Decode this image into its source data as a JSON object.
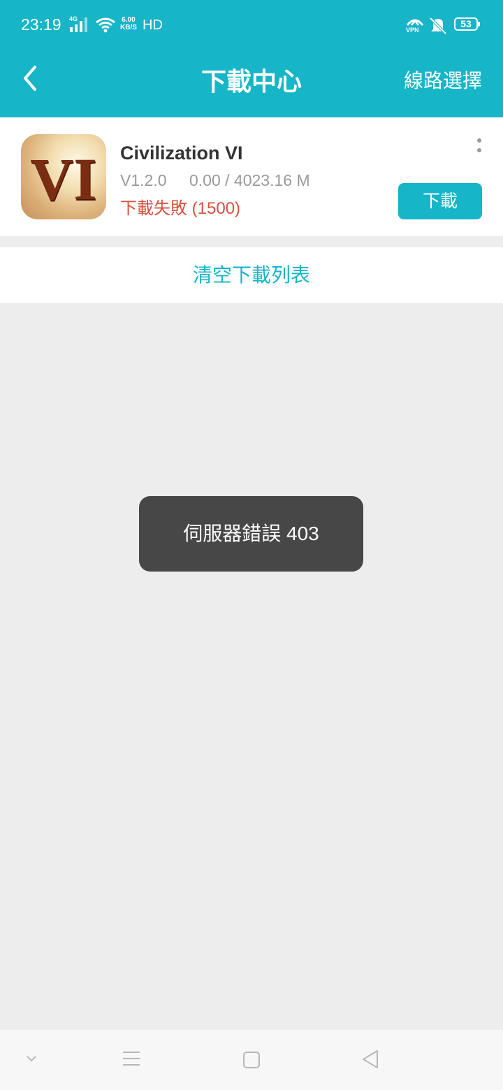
{
  "status_bar": {
    "time": "23:19",
    "network_type": "4G",
    "speed_value": "6.00",
    "speed_unit": "KB/S",
    "hd": "HD",
    "vpn": "VPN",
    "battery": "53",
    "icons": [
      "signal-icon",
      "wifi-icon",
      "vpn-icon",
      "mute-icon",
      "battery-icon"
    ]
  },
  "header": {
    "title": "下載中心",
    "route_label": "線路選擇",
    "accent_color": "#16b5c8"
  },
  "download_item": {
    "name": "Civilization VI",
    "icon_text": "VI",
    "version": "V1.2.0",
    "size": "0.00 / 4023.16 M",
    "status": "下載失敗 (1500)",
    "status_color": "#d9503f",
    "button_label": "下載"
  },
  "clear_list_label": "清空下載列表",
  "toast": {
    "message": "伺服器錯誤 403"
  },
  "nav_bar": {
    "icons": [
      "hide-nav-icon",
      "menu-icon",
      "home-icon",
      "back-nav-icon"
    ]
  }
}
